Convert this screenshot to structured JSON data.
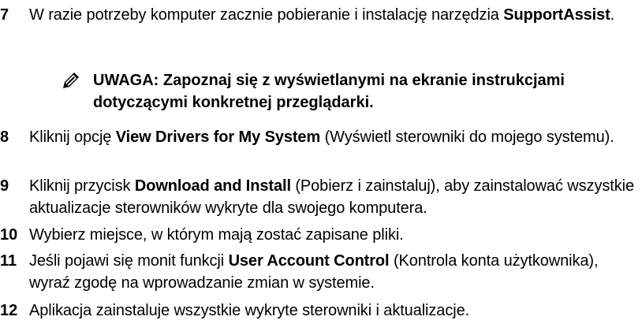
{
  "steps": [
    {
      "number": "7",
      "pre": "W razie potrzeby komputer zacznie pobieranie i instalację narzędzia ",
      "bold": "SupportAssist",
      "post": "."
    },
    {
      "number": "8",
      "pre": "Kliknij opcję ",
      "bold": "View Drivers for My System",
      "post": " (Wyświetl sterowniki do mojego systemu)."
    },
    {
      "number": "9",
      "pre": "Kliknij przycisk ",
      "bold": "Download and Install",
      "post": " (Pobierz i zainstaluj), aby zainstalować wszystkie aktualizacje sterowników wykryte dla swojego komputera."
    },
    {
      "number": "10",
      "text": "Wybierz miejsce, w którym mają zostać zapisane pliki."
    },
    {
      "number": "11",
      "pre": "Jeśli pojawi się monit funkcji ",
      "bold": "User Account Control",
      "post": " (Kontrola konta użytkownika), wyraź zgodę na wprowadzanie zmian w systemie."
    },
    {
      "number": "12",
      "text": "Aplikacja zainstaluje wszystkie wykryte sterowniki i aktualizacje."
    }
  ],
  "note": {
    "icon": "pencil-icon",
    "text": "UWAGA: Zapoznaj się z wyświetlanymi na ekranie instrukcjami dotyczącymi konkretnej przeglądarki."
  }
}
